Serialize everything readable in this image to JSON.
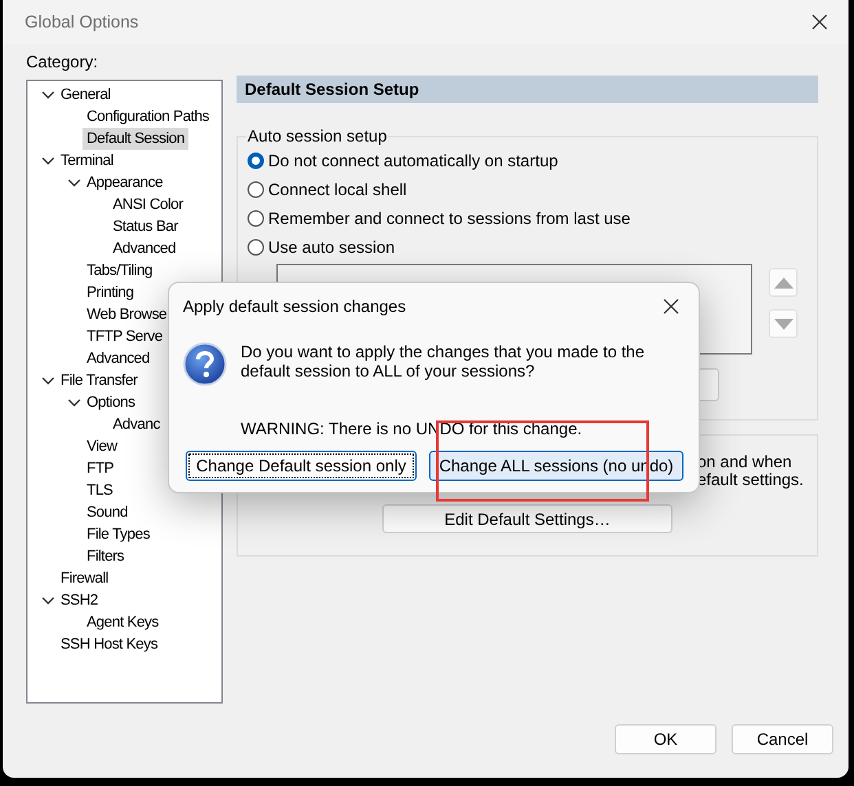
{
  "window": {
    "title": "Global Options"
  },
  "category_label": "Category:",
  "tree": [
    {
      "label": "General",
      "expanded": true,
      "selected": false,
      "children": [
        {
          "label": "Configuration Paths",
          "selected": false
        },
        {
          "label": "Default Session",
          "selected": true
        }
      ]
    },
    {
      "label": "Terminal",
      "expanded": true,
      "selected": false,
      "children": [
        {
          "label": "Appearance",
          "expanded": true,
          "selected": false,
          "children": [
            {
              "label": "ANSI Color",
              "selected": false
            },
            {
              "label": "Status Bar",
              "selected": false
            },
            {
              "label": "Advanced",
              "selected": false
            }
          ]
        },
        {
          "label": "Tabs/Tiling",
          "selected": false
        },
        {
          "label": "Printing",
          "selected": false
        },
        {
          "label": "Web Browse",
          "selected": false
        },
        {
          "label": "TFTP Serve",
          "selected": false
        },
        {
          "label": "Advanced",
          "selected": false
        }
      ]
    },
    {
      "label": "File Transfer",
      "expanded": true,
      "selected": false,
      "children": [
        {
          "label": "Options",
          "expanded": true,
          "selected": false,
          "children": [
            {
              "label": "Advanc",
              "selected": false
            }
          ]
        },
        {
          "label": "View",
          "selected": false
        },
        {
          "label": "FTP",
          "selected": false
        },
        {
          "label": "TLS",
          "selected": false
        },
        {
          "label": "Sound",
          "selected": false
        },
        {
          "label": "File Types",
          "selected": false
        },
        {
          "label": "Filters",
          "selected": false
        }
      ]
    },
    {
      "label": "Firewall",
      "selected": false
    },
    {
      "label": "SSH2",
      "expanded": true,
      "selected": false,
      "children": [
        {
          "label": "Agent Keys",
          "selected": false
        }
      ]
    },
    {
      "label": "SSH Host Keys",
      "selected": false
    }
  ],
  "panel": {
    "header": "Default Session Setup",
    "auto_session": {
      "legend": "Auto session setup",
      "options": [
        {
          "label": "Do not connect automatically on startup",
          "selected": true
        },
        {
          "label": "Connect local shell",
          "selected": false
        },
        {
          "label": "Remember and connect to sessions from last use",
          "selected": false
        },
        {
          "label": "Use auto session",
          "selected": false
        }
      ]
    },
    "description_lines": [
      "on and when",
      "efault settings."
    ],
    "edit_button": "Edit Default Settings…"
  },
  "dialog": {
    "title": "Apply default session changes",
    "message": "Do you want to apply the changes that you made to the default session to ALL of your sessions?",
    "warning": "WARNING: There is no UNDO for this change.",
    "buttons": [
      {
        "label": "Change Default session only",
        "kind": "focused"
      },
      {
        "label": "Change ALL sessions (no undo)",
        "kind": "default"
      }
    ]
  },
  "buttons": [
    "OK",
    "Cancel"
  ]
}
